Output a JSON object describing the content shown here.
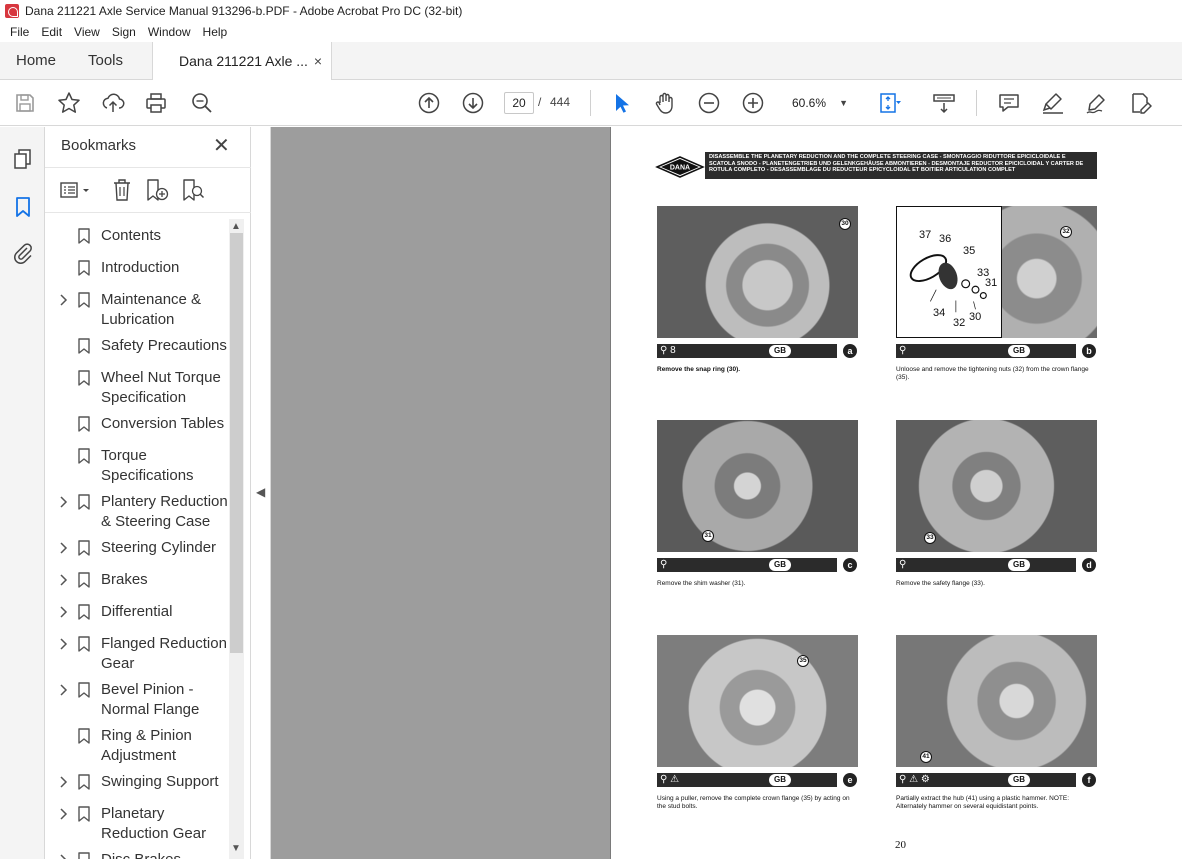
{
  "window": {
    "title": "Dana 211221 Axle Service Manual 913296-b.PDF - Adobe Acrobat Pro DC (32-bit)"
  },
  "menu": [
    "File",
    "Edit",
    "View",
    "Sign",
    "Window",
    "Help"
  ],
  "tabs": {
    "home": "Home",
    "tools": "Tools",
    "document": "Dana 211221 Axle ...",
    "close_glyph": "×"
  },
  "toolbar": {
    "current_page": "20",
    "page_separator": "/",
    "total_pages": "444",
    "zoom": "60.6%",
    "icons": [
      "save-icon",
      "star-icon",
      "upload-icon",
      "print-icon",
      "find-icon",
      "page-up-icon",
      "page-down-icon",
      "select-cursor-icon",
      "hand-icon",
      "zoom-out-icon",
      "zoom-in-icon",
      "fit-page-icon",
      "scroll-mode-icon",
      "comment-icon",
      "highlight-icon",
      "sign-icon",
      "edit-pdf-icon"
    ]
  },
  "bookmarks": {
    "header": "Bookmarks",
    "close_glyph": "✕",
    "items": [
      {
        "label": "Contents",
        "expandable": false
      },
      {
        "label": "Introduction",
        "expandable": false
      },
      {
        "label": "Maintenance & Lubrication",
        "expandable": true
      },
      {
        "label": "Safety Precautions",
        "expandable": false
      },
      {
        "label": "Wheel Nut Torque Specification",
        "expandable": false
      },
      {
        "label": "Conversion Tables",
        "expandable": false
      },
      {
        "label": "Torque Specifications",
        "expandable": false
      },
      {
        "label": "Plantery Reduction & Steering Case",
        "expandable": true
      },
      {
        "label": "Steering Cylinder",
        "expandable": true
      },
      {
        "label": "Brakes",
        "expandable": true
      },
      {
        "label": "Differential",
        "expandable": true
      },
      {
        "label": "Flanged Reduction Gear",
        "expandable": true
      },
      {
        "label": "Bevel Pinion - Normal Flange",
        "expandable": true
      },
      {
        "label": "Ring & Pinion Adjustment",
        "expandable": false
      },
      {
        "label": "Swinging Support",
        "expandable": true
      },
      {
        "label": "Planetary Reduction Gear",
        "expandable": true
      },
      {
        "label": "Disc Brakes",
        "expandable": true
      }
    ]
  },
  "page": {
    "logo": "DANA",
    "header_text": "DISASSEMBLE THE PLANETARY REDUCTION AND THE COMPLETE STEERING CASE - SMONTAGGIO RIDUTTORE EPICICLOIDALE E SCATOLA SNODO - PLANETENGETRIEB UND GELENKGEHÄUSE ABMONTIEREN - DESMONTAJE REDUCTOR EPICICLOIDAL Y CARTER DE ROTULA COMPLETO - DESASSEMBLAGE DU REDUCTEUR EPICYCLOIDAL ET BOITIER ARTICULATION COMPLET",
    "page_number": "20",
    "gb_label": "GB",
    "figures": [
      {
        "letter": "a",
        "symbols": "⚲ 8",
        "callouts": [
          "30"
        ],
        "caption": "Remove the snap ring (30).",
        "bold": true
      },
      {
        "letter": "b",
        "symbols": "⚲",
        "callouts": [
          "32"
        ],
        "caption": "Unloose and remove the tightening nuts (32) from the crown flange (35).",
        "bold": false,
        "diagram_labels": [
          "37",
          "36",
          "35",
          "33",
          "31",
          "34",
          "32",
          "30"
        ]
      },
      {
        "letter": "c",
        "symbols": "⚲",
        "callouts": [
          "31"
        ],
        "caption": "Remove the shim washer (31).",
        "bold": false
      },
      {
        "letter": "d",
        "symbols": "⚲",
        "callouts": [
          "33"
        ],
        "caption": "Remove the safety flange (33).",
        "bold": false
      },
      {
        "letter": "e",
        "symbols": "⚲ ⚠",
        "callouts": [
          "35"
        ],
        "caption": "Using a puller, remove the complete crown flange (35) by acting on the stud bolts.",
        "bold": false
      },
      {
        "letter": "f",
        "symbols": "⚲ ⚠ ⚙",
        "callouts": [
          "41"
        ],
        "caption": "Partially extract the hub (41) using a plastic hammer. NOTE: Alternately hammer on several equidistant points.",
        "bold": false
      }
    ]
  }
}
